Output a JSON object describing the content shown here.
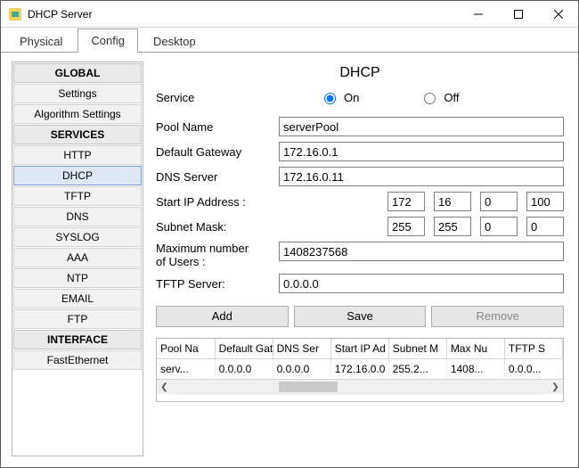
{
  "window": {
    "title": "DHCP Server"
  },
  "tabs": [
    {
      "label": "Physical",
      "active": false
    },
    {
      "label": "Config",
      "active": true
    },
    {
      "label": "Desktop",
      "active": false
    }
  ],
  "sidebar": {
    "groups": [
      {
        "header": "GLOBAL",
        "items": [
          "Settings",
          "Algorithm Settings"
        ]
      },
      {
        "header": "SERVICES",
        "items": [
          "HTTP",
          "DHCP",
          "TFTP",
          "DNS",
          "SYSLOG",
          "AAA",
          "NTP",
          "EMAIL",
          "FTP"
        ]
      },
      {
        "header": "INTERFACE",
        "items": [
          "FastEthernet"
        ]
      }
    ],
    "selected": "DHCP"
  },
  "main": {
    "title": "DHCP",
    "service_label": "Service",
    "on_label": "On",
    "off_label": "Off",
    "service_value": "On",
    "pool_name_label": "Pool Name",
    "pool_name_value": "serverPool",
    "default_gw_label": "Default Gateway",
    "default_gw_value": "172.16.0.1",
    "dns_label": "DNS Server",
    "dns_value": "172.16.0.11",
    "start_ip_label": "Start IP Address :",
    "start_ip": [
      "172",
      "16",
      "0",
      "100"
    ],
    "subnet_label": "Subnet Mask:",
    "subnet": [
      "255",
      "255",
      "0",
      "0"
    ],
    "max_users_label_1": "Maximum number",
    "max_users_label_2": " of Users :",
    "max_users_value": "1408237568",
    "tftp_label": "TFTP Server:",
    "tftp_value": "0.0.0.0",
    "buttons": {
      "add": "Add",
      "save": "Save",
      "remove": "Remove"
    }
  },
  "table": {
    "columns": [
      "Pool Na",
      "Default Gat",
      "DNS Ser",
      "Start IP Ad",
      "Subnet M",
      "Max Nu",
      "TFTP S"
    ],
    "rows": [
      [
        "serv...",
        "0.0.0.0",
        "0.0.0.0",
        "172.16.0.0",
        "255.2...",
        "1408...",
        "0.0.0..."
      ]
    ]
  }
}
